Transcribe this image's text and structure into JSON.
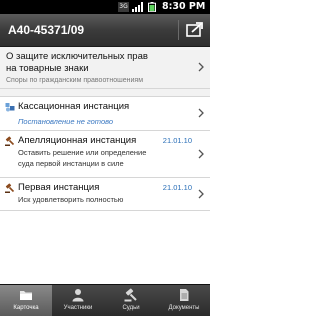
{
  "status_bar": {
    "network": "3G",
    "time": "8:30 PM",
    "icons": [
      "3g-icon",
      "signal-icon",
      "battery-icon"
    ]
  },
  "header": {
    "case_number": "А40-45371/09",
    "action_icon": "share-icon"
  },
  "topic": {
    "line1": "О защите исключительных прав",
    "line2": "на товарные знаки",
    "category": "Споры по гражданским правоотношениям"
  },
  "instances": [
    {
      "title": "Кассационная инстанция",
      "status": "Постановление не готово",
      "icon": "cassation-icon"
    },
    {
      "title": "Апелляционная инстанция",
      "date": "21.01.10",
      "decision_line1": "Оставить решение или определение",
      "decision_line2": "суда первой инстанции в силе",
      "icon": "gavel-icon"
    },
    {
      "title": "Первая инстанция",
      "date": "21.01.10",
      "decision_line1": "Иск удовлетворить полностью",
      "icon": "gavel-icon"
    }
  ],
  "tabs": [
    {
      "label": "Карточка",
      "icon": "folder-icon",
      "active": true
    },
    {
      "label": "Участники",
      "icon": "person-icon",
      "active": false
    },
    {
      "label": "Судьи",
      "icon": "gavel-icon",
      "active": false
    },
    {
      "label": "Документы",
      "icon": "document-icon",
      "active": false
    }
  ],
  "colors": {
    "link_blue": "#2a6fb8",
    "header_bg": "#3b3b3b",
    "tabbar_bg": "#2a2a2a"
  }
}
